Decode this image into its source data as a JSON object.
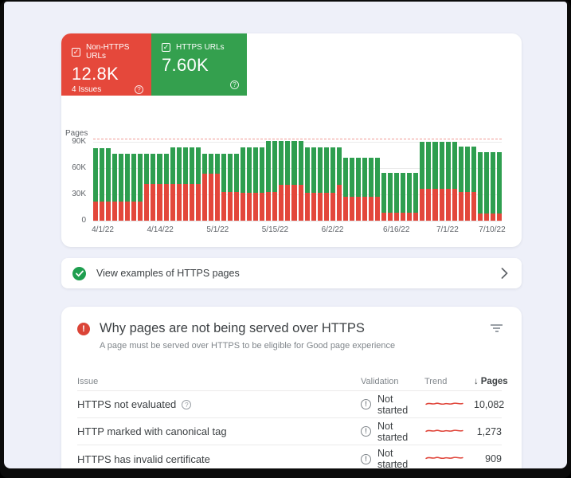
{
  "metrics": {
    "non_https": {
      "label": "Non-HTTPS URLs",
      "value": "12.8K",
      "issues": "4 Issues",
      "color": "#e5483b",
      "checked": "✓",
      "help": "?"
    },
    "https": {
      "label": "HTTPS URLs",
      "value": "7.60K",
      "color": "#34a04e",
      "checked": "✓",
      "help": "?"
    }
  },
  "chart_data": {
    "type": "bar",
    "subtype": "stacked",
    "ylabel": "Pages",
    "unit": "K pages",
    "ymax": 90,
    "yticks": [
      {
        "label": "90K",
        "value": 90
      },
      {
        "label": "60K",
        "value": 60
      },
      {
        "label": "30K",
        "value": 30
      },
      {
        "label": "0",
        "value": 0
      }
    ],
    "grid": true,
    "x_ticks": [
      {
        "label": "4/1/22",
        "bar": 1
      },
      {
        "label": "4/14/22",
        "bar": 10
      },
      {
        "label": "5/1/22",
        "bar": 19
      },
      {
        "label": "5/15/22",
        "bar": 28
      },
      {
        "label": "6/2/22",
        "bar": 37
      },
      {
        "label": "6/16/22",
        "bar": 47
      },
      {
        "label": "7/1/22",
        "bar": 55
      },
      {
        "label": "7/10/22",
        "bar": 62
      }
    ],
    "series": [
      {
        "name": "Non-HTTPS URLs",
        "color": "#e3473b",
        "values": [
          22,
          22,
          22,
          22,
          22,
          22,
          22,
          22,
          42,
          42,
          42,
          42,
          42,
          42,
          42,
          42,
          42,
          54,
          54,
          54,
          33,
          33,
          33,
          32,
          32,
          32,
          32,
          33,
          33,
          41,
          41,
          41,
          41,
          32,
          32,
          32,
          32,
          32,
          41,
          27,
          27,
          27,
          27,
          27,
          27,
          9,
          9,
          9,
          9,
          9,
          9,
          36,
          36,
          36,
          36,
          36,
          36,
          33,
          33,
          33,
          8,
          8,
          8,
          8
        ]
      },
      {
        "name": "HTTPS URLs",
        "color": "#2e9e4f",
        "values": [
          61,
          61,
          61,
          54,
          54,
          54,
          54,
          54,
          34,
          34,
          34,
          34,
          42,
          42,
          42,
          42,
          42,
          22,
          22,
          22,
          43,
          43,
          43,
          52,
          52,
          52,
          52,
          58,
          58,
          50,
          50,
          50,
          50,
          52,
          52,
          52,
          52,
          52,
          43,
          45,
          45,
          45,
          45,
          45,
          45,
          46,
          46,
          46,
          46,
          46,
          46,
          54,
          54,
          54,
          54,
          54,
          54,
          52,
          52,
          52,
          70,
          70,
          70,
          70
        ]
      }
    ]
  },
  "view_examples": {
    "label": "View examples of HTTPS pages"
  },
  "issues_panel": {
    "title": "Why pages are not being served over HTTPS",
    "subtitle": "A page must be served over HTTPS to be eligible for Good page experience",
    "sort_arrow": "↓",
    "columns": {
      "issue": "Issue",
      "validation": "Validation",
      "trend": "Trend",
      "pages": "Pages"
    },
    "rows": [
      {
        "issue": "HTTPS not evaluated",
        "has_help": true,
        "validation": "Not started",
        "pages": "10,082"
      },
      {
        "issue": "HTTP marked with canonical tag",
        "has_help": false,
        "validation": "Not started",
        "pages": "1,273"
      },
      {
        "issue": "HTTPS has invalid certificate",
        "has_help": false,
        "validation": "Not started",
        "pages": "909"
      }
    ]
  }
}
